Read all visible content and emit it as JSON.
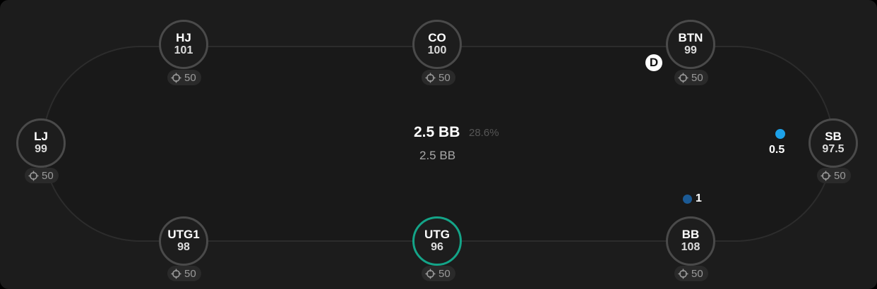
{
  "seats": [
    {
      "position": "HJ",
      "stack": "101",
      "pill": "50",
      "active": false
    },
    {
      "position": "CO",
      "stack": "100",
      "pill": "50",
      "active": false
    },
    {
      "position": "BTN",
      "stack": "99",
      "pill": "50",
      "active": false
    },
    {
      "position": "LJ",
      "stack": "99",
      "pill": "50",
      "active": false
    },
    {
      "position": "SB",
      "stack": "97.5",
      "pill": "50",
      "active": false
    },
    {
      "position": "UTG1",
      "stack": "98",
      "pill": "50",
      "active": false
    },
    {
      "position": "UTG",
      "stack": "96",
      "pill": "50",
      "active": true
    },
    {
      "position": "BB",
      "stack": "108",
      "pill": "50",
      "active": false
    }
  ],
  "pot": {
    "main": "2.5 BB",
    "percent": "28.6%",
    "sub": "2.5 BB"
  },
  "dealer_button": {
    "label": "D",
    "seat": "BTN"
  },
  "bets": [
    {
      "seat": "SB",
      "amount": "0.5",
      "chip_color": "#1da1e8"
    },
    {
      "seat": "BB",
      "amount": "1",
      "chip_color": "#1b5a95"
    }
  ],
  "colors": {
    "active_ring": "#14a488",
    "seat_ring": "#4a4a4a"
  },
  "icons": {
    "pill_icon": "crosshair-icon"
  }
}
